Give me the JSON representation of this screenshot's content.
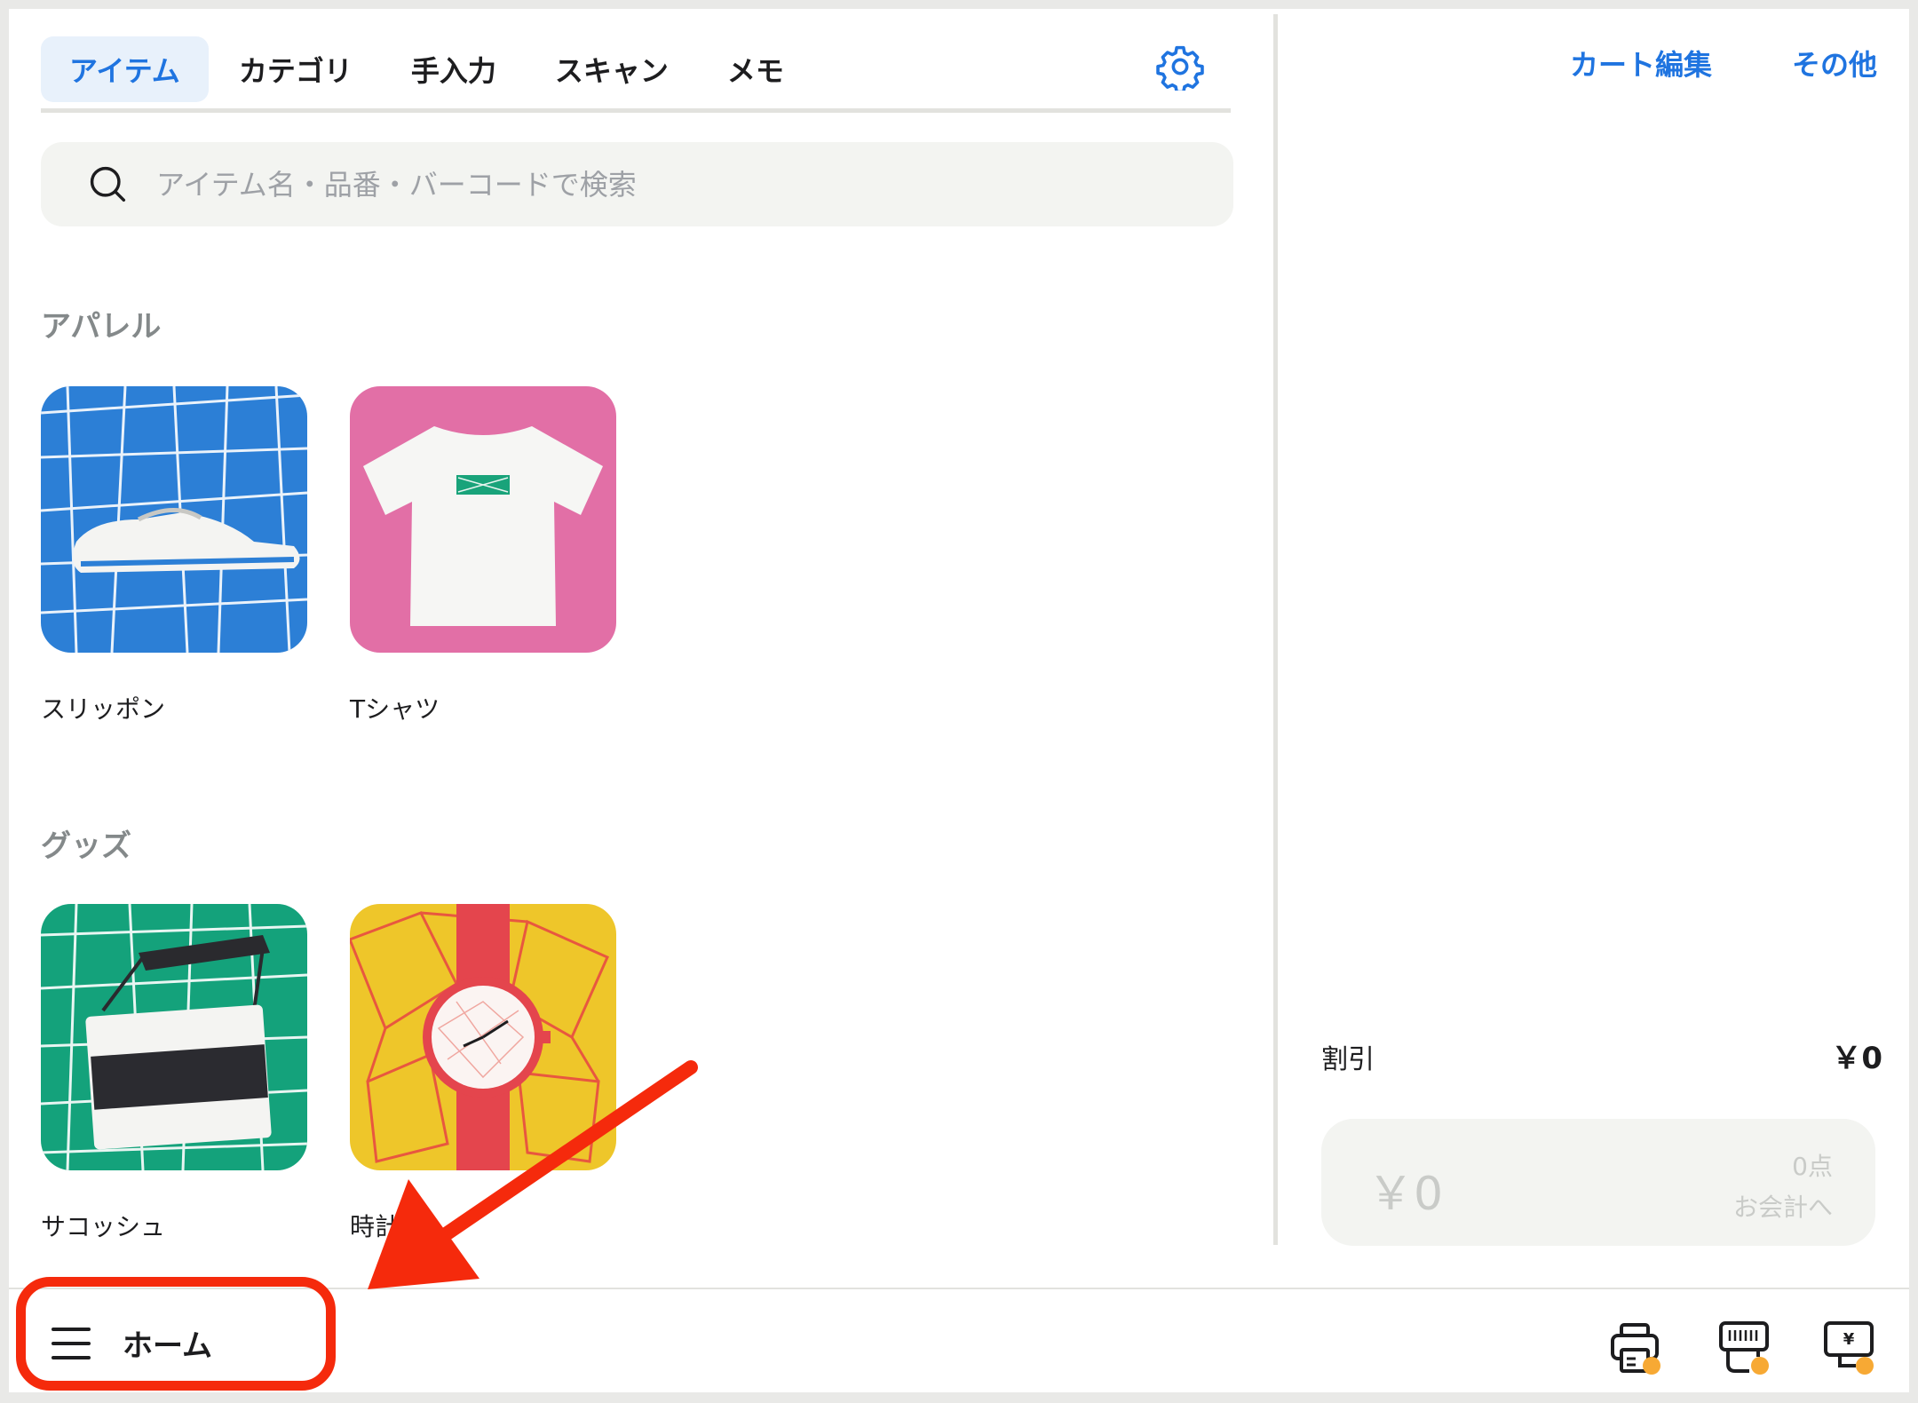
{
  "tabs": [
    {
      "label": "アイテム",
      "active": true
    },
    {
      "label": "カテゴリ",
      "active": false
    },
    {
      "label": "手入力",
      "active": false
    },
    {
      "label": "スキャン",
      "active": false
    },
    {
      "label": "メモ",
      "active": false
    }
  ],
  "search": {
    "placeholder": "アイテム名・品番・バーコードで検索"
  },
  "sections": [
    {
      "title": "アパレル",
      "items": [
        {
          "label": "スリッポン"
        },
        {
          "label": "Tシャツ"
        }
      ]
    },
    {
      "title": "グッズ",
      "items": [
        {
          "label": "サコッシュ"
        },
        {
          "label": "時計"
        }
      ]
    }
  ],
  "cart": {
    "edit_label": "カート編集",
    "more_label": "その他",
    "discount_label": "割引",
    "discount_value": "￥0",
    "total": "￥0",
    "count": "0点",
    "checkout_label": "お会計へ"
  },
  "bottom": {
    "home_label": "ホーム"
  },
  "colors": {
    "accent": "#1f74e0",
    "annotation": "#f52a0c",
    "status_dot": "#f7a934"
  },
  "icons": [
    "gear-icon",
    "search-icon",
    "menu-icon",
    "printer-icon",
    "card-reader-icon",
    "cash-drawer-icon"
  ]
}
